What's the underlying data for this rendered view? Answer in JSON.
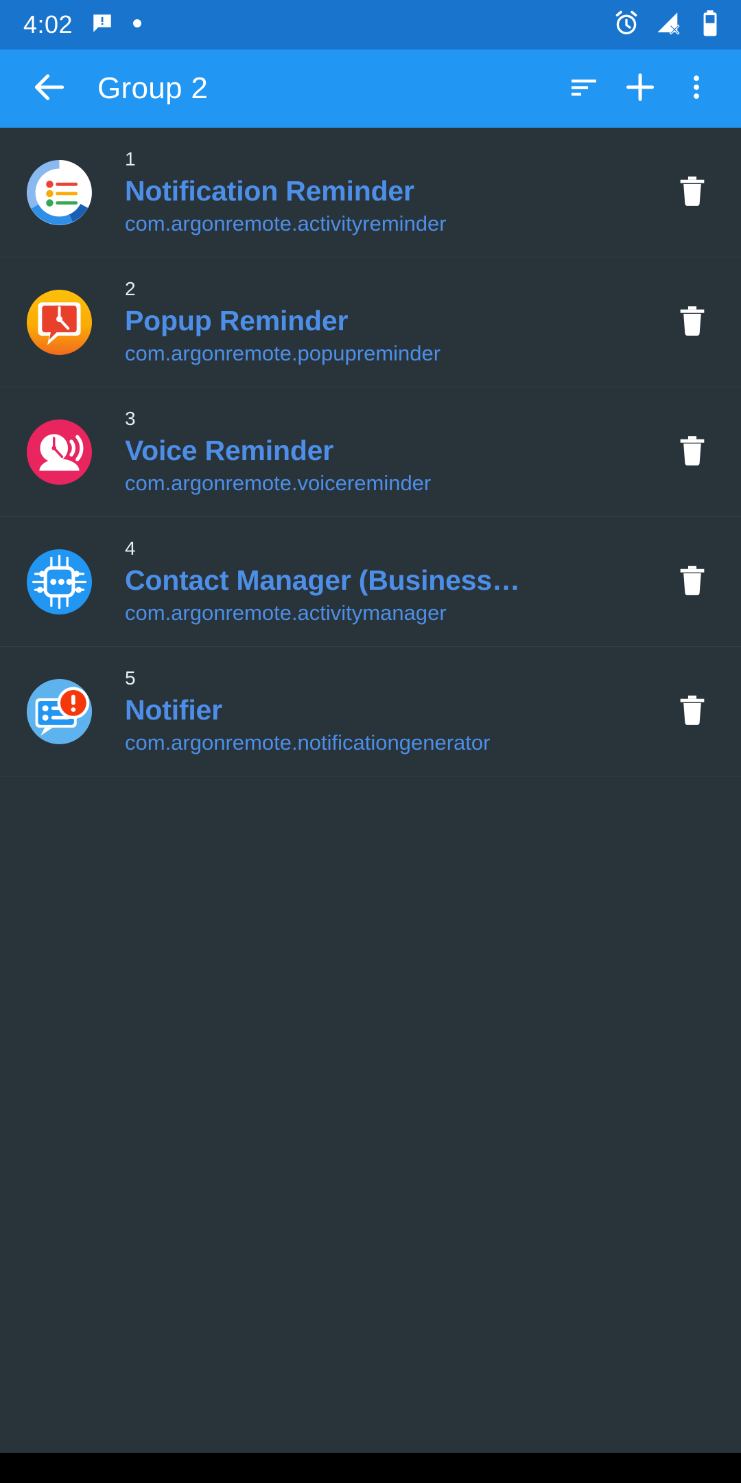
{
  "status_bar": {
    "time": "4:02",
    "left_icons": [
      "message-icon",
      "dot-icon"
    ],
    "right_icons": [
      "alarm-icon",
      "signal-off-icon",
      "battery-icon"
    ],
    "background": "#1874cd"
  },
  "app_bar": {
    "title": "Group 2",
    "background": "#2196f3",
    "back_icon": "arrow-back-icon",
    "actions": [
      {
        "name": "sort-icon",
        "label": "Sort"
      },
      {
        "name": "add-icon",
        "label": "Add"
      },
      {
        "name": "overflow-menu-icon",
        "label": "More options"
      }
    ]
  },
  "theme": {
    "list_background": "#28333a",
    "divider": "#323e46",
    "title_color": "#4d8fe8",
    "index_color": "#e8eef2",
    "delete_icon_color": "#ffffff"
  },
  "list": {
    "delete_label": "Delete",
    "items": [
      {
        "index": "1",
        "title": "Notification Reminder",
        "package": "com.argonremote.activityreminder",
        "icon": "notification-reminder-icon"
      },
      {
        "index": "2",
        "title": "Popup Reminder",
        "package": "com.argonremote.popupreminder",
        "icon": "popup-reminder-icon"
      },
      {
        "index": "3",
        "title": "Voice Reminder",
        "package": "com.argonremote.voicereminder",
        "icon": "voice-reminder-icon"
      },
      {
        "index": "4",
        "title": "Contact Manager (Business…",
        "package": "com.argonremote.activitymanager",
        "icon": "contact-manager-icon"
      },
      {
        "index": "5",
        "title": "Notifier",
        "package": "com.argonremote.notificationgenerator",
        "icon": "notifier-icon"
      }
    ]
  }
}
